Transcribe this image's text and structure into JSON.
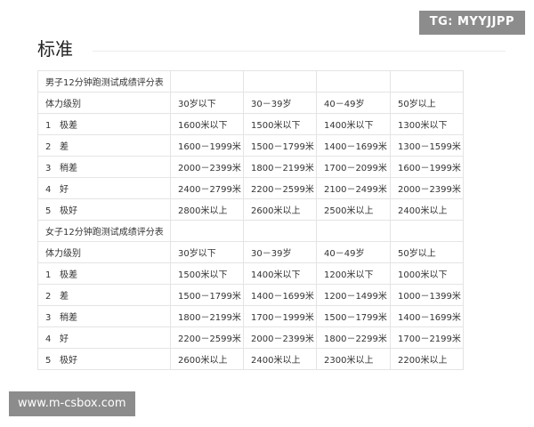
{
  "watermarks": {
    "top": "TG: MYYJJPP",
    "bottom": "www.m-csbox.com"
  },
  "heading": "标准",
  "male": {
    "title": "男子12分钟跑测试成绩评分表",
    "header": [
      "体力级别",
      "30岁以下",
      "30－39岁",
      "40－49岁",
      "50岁以上"
    ],
    "rows": [
      {
        "num": "1",
        "level": "极差",
        "cells": [
          "1600米以下",
          "1500米以下",
          "1400米以下",
          "1300米以下"
        ]
      },
      {
        "num": "2",
        "level": "差",
        "cells": [
          "1600－1999米",
          "1500－1799米",
          "1400－1699米",
          "1300－1599米"
        ]
      },
      {
        "num": "3",
        "level": "稍差",
        "cells": [
          "2000－2399米",
          "1800－2199米",
          "1700－2099米",
          "1600－1999米"
        ]
      },
      {
        "num": "4",
        "level": "好",
        "cells": [
          "2400－2799米",
          "2200－2599米",
          "2100－2499米",
          "2000－2399米"
        ]
      },
      {
        "num": "5",
        "level": "极好",
        "cells": [
          "2800米以上",
          "2600米以上",
          "2500米以上",
          "2400米以上"
        ]
      }
    ]
  },
  "female": {
    "title": "女子12分钟跑测试成绩评分表",
    "header": [
      "体力级别",
      "30岁以下",
      "30－39岁",
      "40－49岁",
      "50岁以上"
    ],
    "rows": [
      {
        "num": "1",
        "level": "极差",
        "cells": [
          "1500米以下",
          "1400米以下",
          "1200米以下",
          "1000米以下"
        ]
      },
      {
        "num": "2",
        "level": "差",
        "cells": [
          "1500－1799米",
          "1400－1699米",
          "1200－1499米",
          "1000－1399米"
        ]
      },
      {
        "num": "3",
        "level": "稍差",
        "cells": [
          "1800－2199米",
          "1700－1999米",
          "1500－1799米",
          "1400－1699米"
        ]
      },
      {
        "num": "4",
        "level": "好",
        "cells": [
          "2200－2599米",
          "2000－2399米",
          "1800－2299米",
          "1700－2199米"
        ]
      },
      {
        "num": "5",
        "level": "极好",
        "cells": [
          "2600米以上",
          "2400米以上",
          "2300米以上",
          "2200米以上"
        ]
      }
    ]
  }
}
